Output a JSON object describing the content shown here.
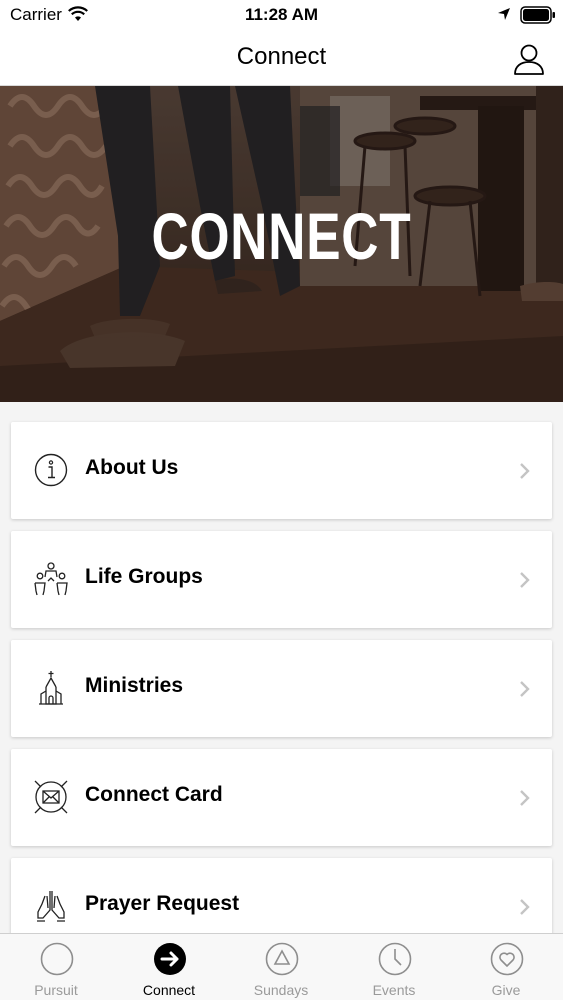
{
  "status_bar": {
    "carrier": "Carrier",
    "time": "11:28 AM"
  },
  "nav": {
    "title": "Connect"
  },
  "hero": {
    "title": "CONNECT"
  },
  "menu": [
    {
      "label": "About Us",
      "icon": "info-icon"
    },
    {
      "label": "Life Groups",
      "icon": "people-icon"
    },
    {
      "label": "Ministries",
      "icon": "church-icon"
    },
    {
      "label": "Connect Card",
      "icon": "envelope-icon"
    },
    {
      "label": "Prayer Request",
      "icon": "praying-hands-icon"
    }
  ],
  "tabs": [
    {
      "label": "Pursuit",
      "icon": "circle-icon",
      "active": false
    },
    {
      "label": "Connect",
      "icon": "arrow-right-icon",
      "active": true
    },
    {
      "label": "Sundays",
      "icon": "triangle-icon",
      "active": false
    },
    {
      "label": "Events",
      "icon": "clock-icon",
      "active": false
    },
    {
      "label": "Give",
      "icon": "heart-icon",
      "active": false
    }
  ]
}
